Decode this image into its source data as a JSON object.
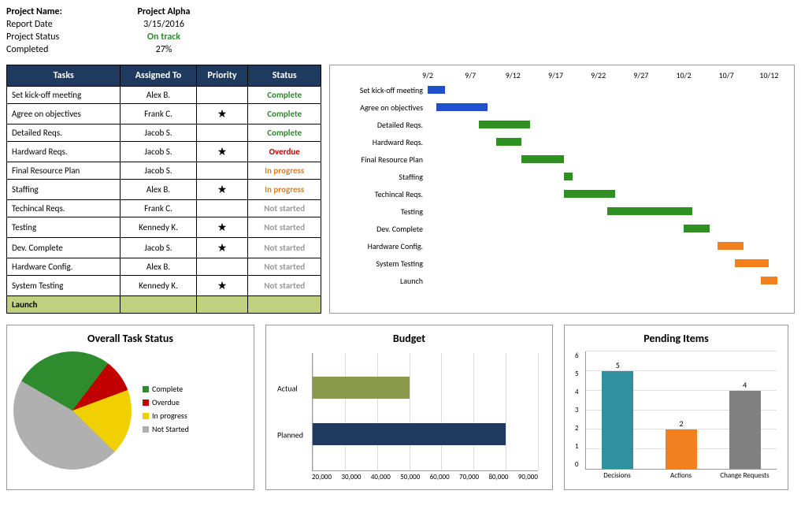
{
  "header": {
    "project_name_label": "Project Name:",
    "project_name": "Project Alpha",
    "report_date_label": "Report Date",
    "report_date": "3/15/2016",
    "status_label": "Project Status",
    "status": "On track",
    "completed_label": "Completed",
    "completed": "27%"
  },
  "table": {
    "cols": [
      "Tasks",
      "Assigned To",
      "Priority",
      "Status"
    ],
    "rows": [
      {
        "task": "Set kick-off meeting",
        "assigned": "Alex B.",
        "priority": "",
        "status": "Complete",
        "cls": "green bold"
      },
      {
        "task": "Agree on objectives",
        "assigned": "Frank C.",
        "priority": "★",
        "status": "Complete",
        "cls": "green bold"
      },
      {
        "task": "Detailed Reqs.",
        "assigned": "Jacob S.",
        "priority": "",
        "status": "Complete",
        "cls": "green bold"
      },
      {
        "task": "Hardward Reqs.",
        "assigned": "Jacob S.",
        "priority": "★",
        "status": "Overdue",
        "cls": "red bold"
      },
      {
        "task": "Final Resource Plan",
        "assigned": "Jacob S.",
        "priority": "",
        "status": "In progress",
        "cls": "orange bold"
      },
      {
        "task": "Staffing",
        "assigned": "Alex B.",
        "priority": "★",
        "status": "In progress",
        "cls": "orange bold"
      },
      {
        "task": "Techincal Reqs.",
        "assigned": "Frank C.",
        "priority": "",
        "status": "Not started",
        "cls": "gray bold"
      },
      {
        "task": "Testing",
        "assigned": "Kennedy K.",
        "priority": "★",
        "status": "Not started",
        "cls": "gray bold"
      },
      {
        "task": "Dev. Complete",
        "assigned": "Jacob S.",
        "priority": "★",
        "status": "Not started",
        "cls": "gray bold"
      },
      {
        "task": "Hardware Config.",
        "assigned": "Alex B.",
        "priority": "",
        "status": "Not started",
        "cls": "gray bold"
      },
      {
        "task": "System Testing",
        "assigned": "Kennedy K.",
        "priority": "★",
        "status": "Not started",
        "cls": "gray bold"
      }
    ],
    "launch": "Launch"
  },
  "chart_data": [
    {
      "type": "gantt",
      "title": "",
      "x_ticks": [
        "9/2",
        "9/7",
        "9/12",
        "9/17",
        "9/22",
        "9/27",
        "10/2",
        "10/7",
        "10/12"
      ],
      "x_range": [
        0,
        42
      ],
      "rows": [
        {
          "label": "Set kick-off meeting",
          "start": 0,
          "end": 2,
          "color": "blue"
        },
        {
          "label": "Agree on objectives",
          "start": 1,
          "end": 7,
          "color": "blue"
        },
        {
          "label": "Detailed Reqs.",
          "start": 6,
          "end": 12,
          "color": "green"
        },
        {
          "label": "Hardward Reqs.",
          "start": 8,
          "end": 11,
          "color": "green"
        },
        {
          "label": "Final Resource Plan",
          "start": 11,
          "end": 16,
          "color": "green"
        },
        {
          "label": "Staffing",
          "start": 16,
          "end": 17,
          "color": "green"
        },
        {
          "label": "Techincal Reqs.",
          "start": 16,
          "end": 22,
          "color": "green"
        },
        {
          "label": "Testing",
          "start": 21,
          "end": 31,
          "color": "green"
        },
        {
          "label": "Dev. Complete",
          "start": 30,
          "end": 33,
          "color": "green"
        },
        {
          "label": "Hardware Config.",
          "start": 34,
          "end": 37,
          "color": "orange"
        },
        {
          "label": "System Testing",
          "start": 36,
          "end": 40,
          "color": "orange"
        },
        {
          "label": "Launch",
          "start": 39,
          "end": 41,
          "color": "orange"
        }
      ]
    },
    {
      "type": "pie",
      "title": "Overall Task Status",
      "series": [
        {
          "name": "Complete",
          "value": 27,
          "color": "#2e8b2e"
        },
        {
          "name": "Overdue",
          "value": 9,
          "color": "#c00000"
        },
        {
          "name": "In progress",
          "value": 18,
          "color": "#f0d000"
        },
        {
          "name": "Not Started",
          "value": 46,
          "color": "#b0b0b0"
        }
      ]
    },
    {
      "type": "bar",
      "orientation": "horizontal",
      "title": "Budget",
      "categories": [
        "Actual",
        "Planned"
      ],
      "values": [
        50000,
        80000
      ],
      "colors": [
        "#8a9a4a",
        "#1f3a5f"
      ],
      "xlim": [
        20000,
        90000
      ],
      "x_ticks": [
        "20,000",
        "30,000",
        "40,000",
        "50,000",
        "60,000",
        "70,000",
        "80,000",
        "90,000"
      ]
    },
    {
      "type": "bar",
      "orientation": "vertical",
      "title": "Pending Items",
      "categories": [
        "Decisions",
        "Actions",
        "Change Requests"
      ],
      "values": [
        5,
        2,
        4
      ],
      "colors": [
        "#3090a0",
        "#f08020",
        "#808080"
      ],
      "ylim": [
        0,
        6
      ],
      "y_ticks": [
        "0",
        "1",
        "2",
        "3",
        "4",
        "5",
        "6"
      ]
    }
  ]
}
